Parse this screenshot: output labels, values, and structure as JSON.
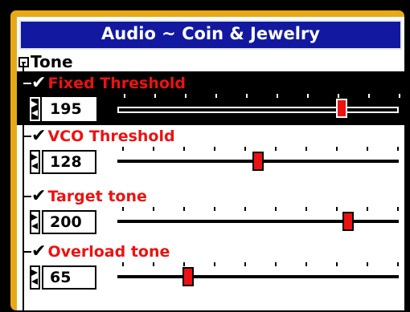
{
  "title": "Audio ~ Coin & Jewelry",
  "group": {
    "label": "Tone"
  },
  "items": [
    {
      "label": "Fixed Threshold",
      "value": "195",
      "level": 0.79,
      "selected": true
    },
    {
      "label": "VCO Threshold",
      "value": "128",
      "level": 0.5,
      "selected": false
    },
    {
      "label": "Target tone",
      "value": "200",
      "level": 0.82,
      "selected": false
    },
    {
      "label": "Overload tone",
      "value": "65",
      "level": 0.25,
      "selected": false
    }
  ],
  "colors": {
    "accent": "#ee1111",
    "titlebar": "#1219a0",
    "bezel": "#e8a817"
  }
}
